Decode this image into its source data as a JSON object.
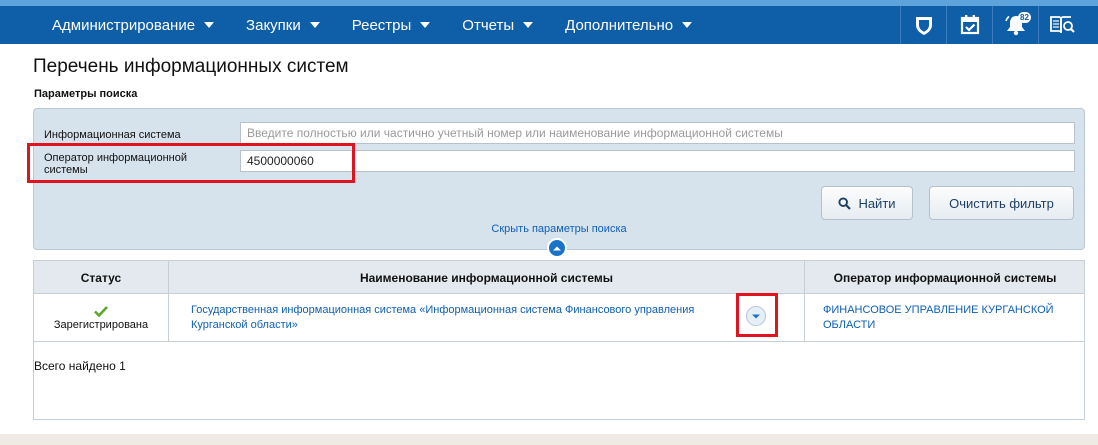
{
  "nav": {
    "menu": [
      {
        "label": "Администрирование",
        "caret": true
      },
      {
        "label": "Закупки",
        "caret": true
      },
      {
        "label": "Реестры",
        "caret": true
      },
      {
        "label": "Отчеты",
        "caret": true
      },
      {
        "label": "Дополнительно",
        "caret": true
      }
    ],
    "icons": [
      "shield-icon",
      "calendar-check-icon",
      "bell-icon",
      "book-search-icon"
    ],
    "notifications_count": "82"
  },
  "page": {
    "title": "Перечень информационных систем",
    "search_params_label": "Параметры поиска"
  },
  "search": {
    "is_label": "Информационная система",
    "is_placeholder": "Введите полностью или частично учетный номер или наименование информационной системы",
    "is_value": "",
    "operator_label": "Оператор информационной системы",
    "operator_value": "4500000060",
    "find_button": "Найти",
    "clear_button": "Очистить фильтр",
    "hide_link": "Скрыть параметры поиска"
  },
  "table": {
    "columns": [
      "Статус",
      "Наименование информационной системы",
      "Оператор информационной системы"
    ],
    "rows": [
      {
        "status": "Зарегистрирована",
        "name": "Государственная информационная система «Информационная система Финансового управления Курганской области»",
        "operator": "ФИНАНСОВОЕ УПРАВЛЕНИЕ КУРГАНСКОЙ ОБЛАСТИ"
      }
    ],
    "total_found": "Всего найдено 1"
  },
  "colors": {
    "nav_bg": "#0f5ea8",
    "link": "#0e5fb5",
    "panel_bg": "#d6e2ec",
    "highlight": "#e0141e",
    "status_ok": "#5aa82c"
  }
}
